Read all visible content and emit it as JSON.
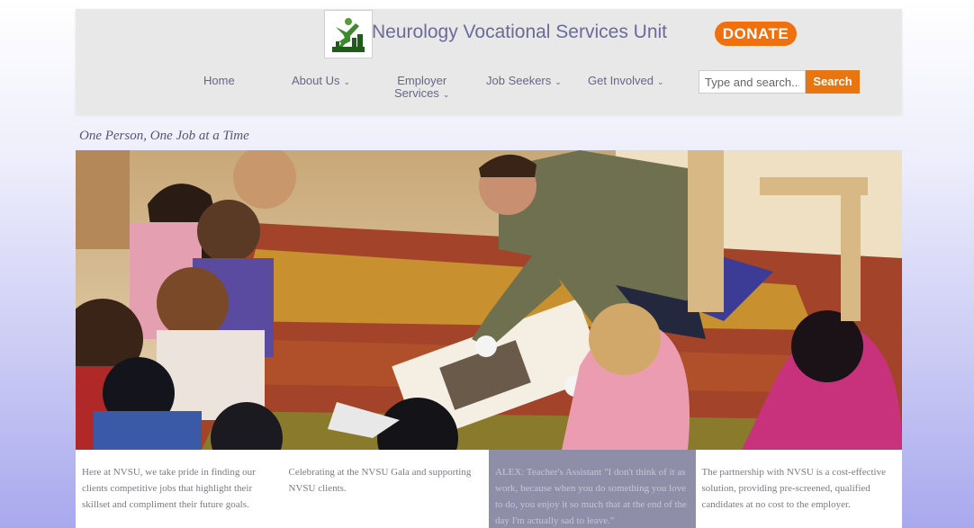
{
  "header": {
    "title": "Neurology Vocational Services Unit",
    "donate_label": "DONATE",
    "logo_icon": "nvsu-logo-icon",
    "accent_color": "#f07010"
  },
  "nav": {
    "home": "Home",
    "about": "About Us",
    "employer_line1": "Employer",
    "employer_line2": "Services",
    "job_seekers": "Job Seekers",
    "get_involved": "Get Involved",
    "caret": "⌄"
  },
  "search": {
    "placeholder": "Type and search...",
    "button_label": "Search"
  },
  "tagline": "One Person, One Job at a Time",
  "panels": [
    "Here at NVSU, we take pride in finding our clients competitive jobs that highlight their skillset and compliment their future goals.",
    "Celebrating at the NVSU Gala and supporting NVSU clients.",
    "ALEX: Teacher's Assistant \"I don't think of it as work, because when you do something you love to do, you enjoy it so much that at the end of the day I'm actually sad to leave.\"",
    "The partnership with NVSU is a cost-effective solution, providing pre-screened, qualified candidates at no cost to the employer."
  ]
}
